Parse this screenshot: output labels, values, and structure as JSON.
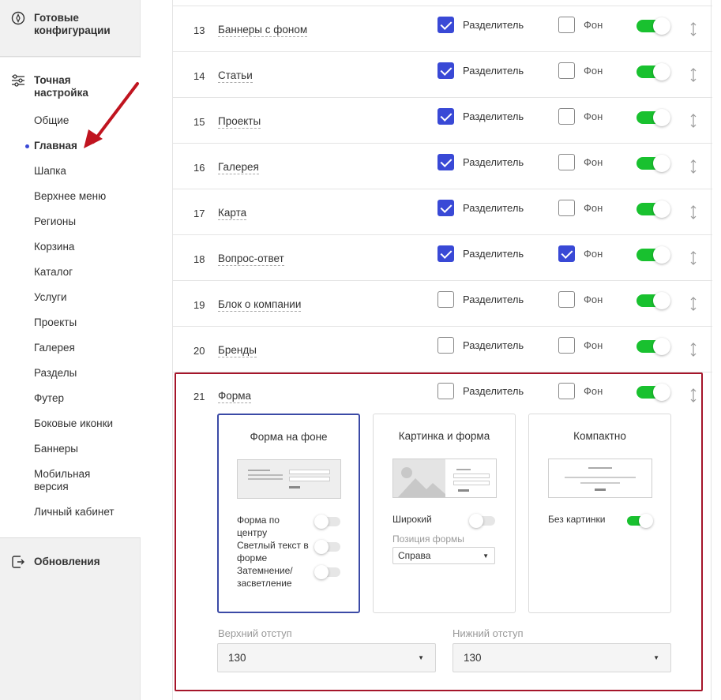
{
  "sidebar": {
    "ready_configs": "Готовые конфигурации",
    "fine_tuning": "Точная настройка",
    "items": [
      {
        "label": "Общие"
      },
      {
        "label": "Главная"
      },
      {
        "label": "Шапка"
      },
      {
        "label": "Верхнее меню"
      },
      {
        "label": "Регионы"
      },
      {
        "label": "Корзина"
      },
      {
        "label": "Каталог"
      },
      {
        "label": "Услуги"
      },
      {
        "label": "Проекты"
      },
      {
        "label": "Галерея"
      },
      {
        "label": "Разделы"
      },
      {
        "label": "Футер"
      },
      {
        "label": "Боковые иконки"
      },
      {
        "label": "Баннеры"
      },
      {
        "label": "Мобильная версия"
      },
      {
        "label": "Личный кабинет"
      }
    ],
    "active_index": 1,
    "updates": "Обновления"
  },
  "rows": [
    {
      "num": "13",
      "name": "Баннеры с фоном",
      "divider": true,
      "background": false,
      "enabled": true
    },
    {
      "num": "14",
      "name": "Статьи",
      "divider": true,
      "background": false,
      "enabled": true
    },
    {
      "num": "15",
      "name": "Проекты",
      "divider": true,
      "background": false,
      "enabled": true
    },
    {
      "num": "16",
      "name": "Галерея",
      "divider": true,
      "background": false,
      "enabled": true
    },
    {
      "num": "17",
      "name": "Карта",
      "divider": true,
      "background": false,
      "enabled": true
    },
    {
      "num": "18",
      "name": "Вопрос-ответ",
      "divider": true,
      "background": true,
      "enabled": true
    },
    {
      "num": "19",
      "name": "Блок о компании",
      "divider": false,
      "background": false,
      "enabled": true
    },
    {
      "num": "20",
      "name": "Бренды",
      "divider": false,
      "background": false,
      "enabled": true
    },
    {
      "num": "21",
      "name": "Форма",
      "divider": false,
      "background": false,
      "enabled": true
    }
  ],
  "labels": {
    "divider": "Разделитель",
    "background": "Фон"
  },
  "form_block": {
    "variants": [
      {
        "title": "Форма на фоне",
        "selected": true,
        "options": [
          {
            "label": "Форма по центру",
            "on": false
          },
          {
            "label": "Светлый текст в форме",
            "on": false
          },
          {
            "label": "Затемнение/ засветление",
            "on": false
          }
        ]
      },
      {
        "title": "Картинка и форма",
        "selected": false,
        "options": [
          {
            "label": "Широкий",
            "on": false
          }
        ],
        "position_label": "Позиция формы",
        "position_value": "Справа"
      },
      {
        "title": "Компактно",
        "selected": false,
        "options": [
          {
            "label": "Без картинки",
            "on": true
          }
        ]
      }
    ],
    "top_padding": {
      "label": "Верхний отступ",
      "value": "130"
    },
    "bottom_padding": {
      "label": "Нижний отступ",
      "value": "130"
    }
  },
  "colors": {
    "accent": "#3949d6",
    "toggle_on": "#19c12f",
    "highlight_border": "#a5152a",
    "arrow": "#c0141f"
  }
}
